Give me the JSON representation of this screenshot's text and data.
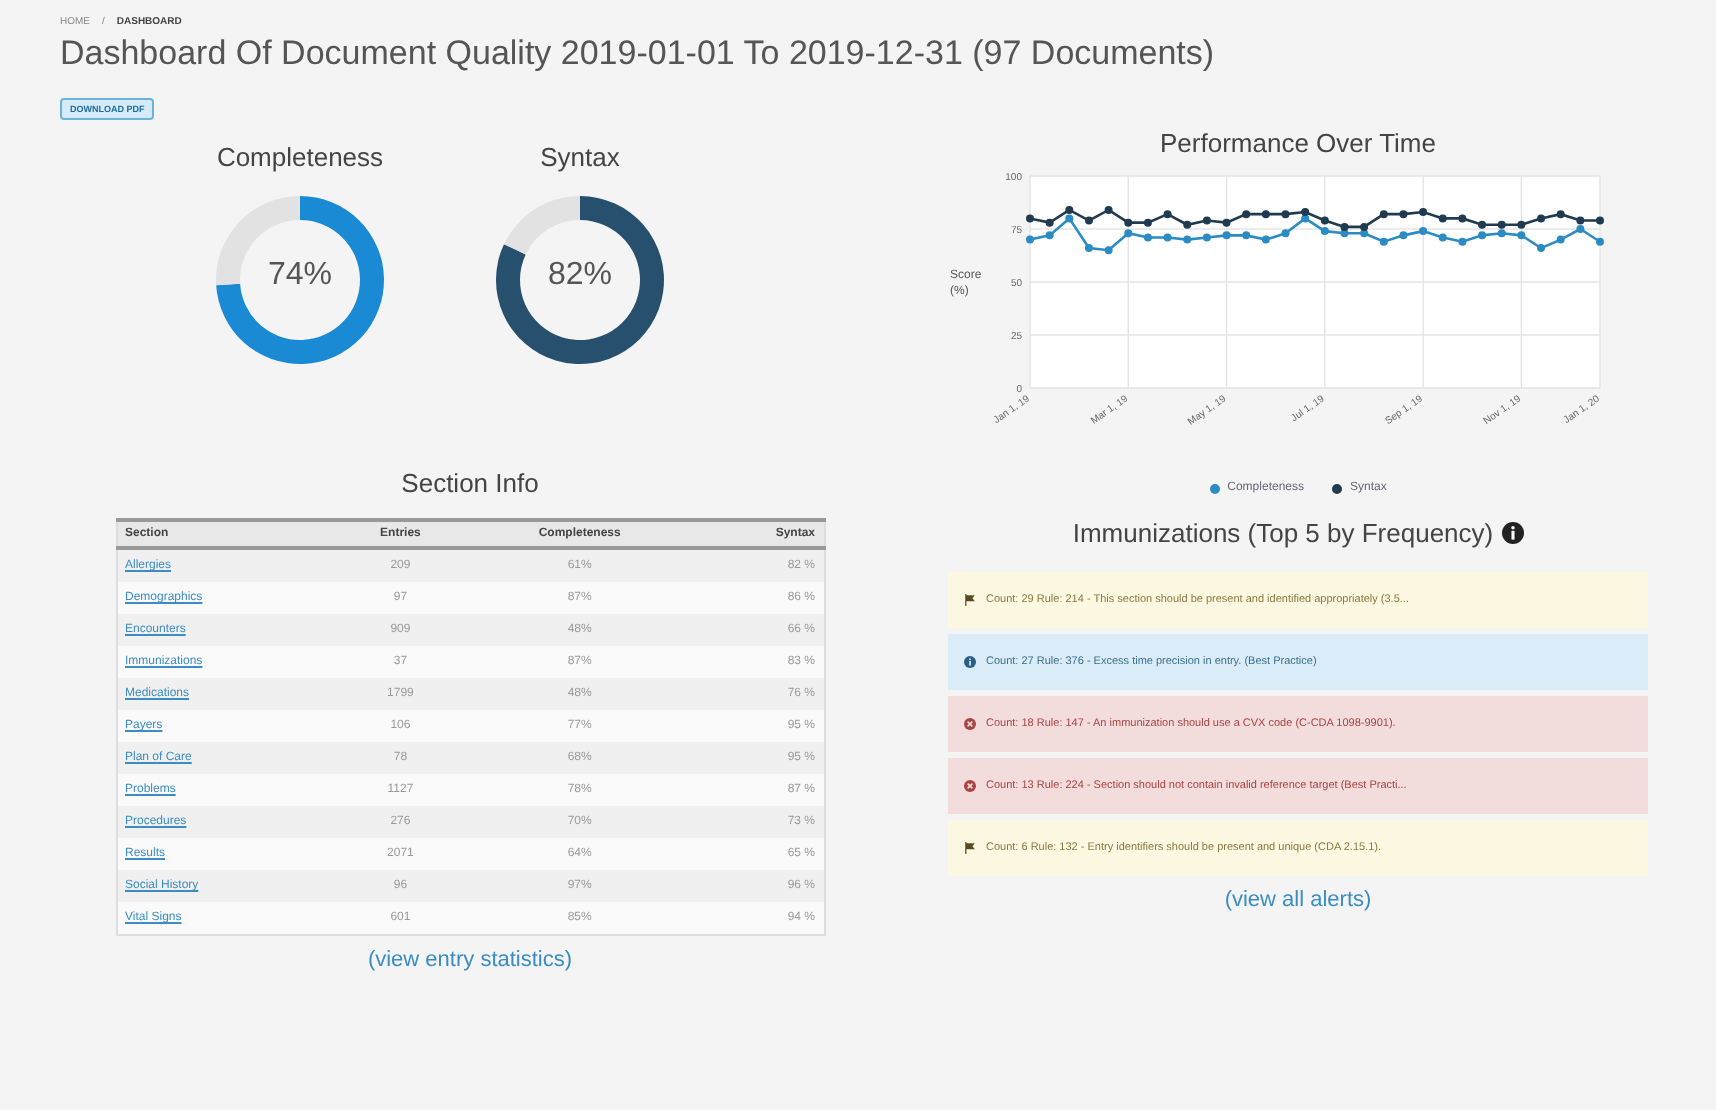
{
  "breadcrumb": [
    "HOME",
    "DASHBOARD"
  ],
  "breadcrumb_separator": "/",
  "title": "Dashboard Of Document Quality 2019-01-01 To 2019-12-31 (97 Documents)",
  "download_button": "DOWNLOAD PDF",
  "gauges": [
    {
      "title": "Completeness",
      "reading": "74%",
      "color": "#1a8ad4",
      "chart_data": {
        "type": "donut",
        "values": [
          74,
          26
        ]
      }
    },
    {
      "title": "Syntax",
      "reading": "82%",
      "color": "#27506e",
      "chart_data": {
        "type": "donut",
        "values": [
          82,
          18
        ]
      }
    }
  ],
  "performance": {
    "chart_data": {
      "type": "line",
      "title": "Performance Over Time",
      "ylabel": "Score (%)",
      "categories": [
        "Jan 1, 19",
        null,
        null,
        null,
        null,
        "Mar 1, 19",
        null,
        null,
        null,
        null,
        "May 1, 19",
        null,
        null,
        null,
        null,
        "Jul 1, 19",
        null,
        null,
        null,
        null,
        "Sep 1, 19",
        null,
        null,
        null,
        null,
        "Nov 1, 19",
        null,
        null,
        null,
        "Jan 1, 20"
      ],
      "grid": true,
      "ylim": [
        0,
        100
      ],
      "yticks": [
        0,
        25,
        50,
        75,
        100
      ],
      "series": [
        {
          "name": "Completeness",
          "color": "#2b8cc4",
          "marker": "circle",
          "values": [
            70,
            72,
            80,
            66,
            65,
            73,
            71,
            71,
            70,
            71,
            72,
            72,
            70,
            73,
            80,
            74,
            73,
            73,
            69,
            72,
            74,
            71,
            69,
            72,
            73,
            72,
            66,
            70,
            75,
            69
          ]
        },
        {
          "name": "Syntax",
          "color": "#203a4f",
          "marker": "circle",
          "values": [
            80,
            78,
            84,
            79,
            84,
            78,
            78,
            82,
            77,
            79,
            78,
            82,
            82,
            82,
            83,
            79,
            76,
            76,
            82,
            82,
            83,
            80,
            80,
            77,
            77,
            77,
            80,
            82,
            79,
            79
          ]
        }
      ]
    }
  },
  "section_info": {
    "title": "Section Info",
    "columns": [
      "Section",
      "Entries",
      "Completeness",
      "Syntax"
    ],
    "rows": [
      [
        "Allergies",
        "209",
        "61%",
        "82 %"
      ],
      [
        "Demographics",
        "97",
        "87%",
        "86 %"
      ],
      [
        "Encounters",
        "909",
        "48%",
        "66 %"
      ],
      [
        "Immunizations",
        "37",
        "87%",
        "83 %"
      ],
      [
        "Medications",
        "1799",
        "48%",
        "76 %"
      ],
      [
        "Payers",
        "106",
        "77%",
        "95 %"
      ],
      [
        "Plan of Care",
        "78",
        "68%",
        "95 %"
      ],
      [
        "Problems",
        "1127",
        "78%",
        "87 %"
      ],
      [
        "Procedures",
        "276",
        "70%",
        "73 %"
      ],
      [
        "Results",
        "2071",
        "64%",
        "65 %"
      ],
      [
        "Social History",
        "96",
        "97%",
        "96 %"
      ],
      [
        "Vital Signs",
        "601",
        "85%",
        "94 %"
      ]
    ],
    "link": "(view entry statistics)"
  },
  "immunizations": {
    "title": "Immunizations (Top 5 by Frequency)",
    "alerts": [
      {
        "kind": "warning",
        "text": "Count: 29 Rule: 214 - This section should be present and identified appropriately (3.5..."
      },
      {
        "kind": "info",
        "text": "Count: 27 Rule: 376 - Excess time precision in entry. (Best Practice)"
      },
      {
        "kind": "error",
        "text": "Count: 18 Rule: 147 - An immunization should use a CVX code (C-CDA 1098-9901)."
      },
      {
        "kind": "error",
        "text": "Count: 13 Rule: 224 - Section should not contain invalid reference target (Best Practi..."
      },
      {
        "kind": "warning",
        "text": "Count: 6 Rule: 132 - Entry identifiers should be present and unique (CDA 2.15.1)."
      }
    ],
    "link": "(view all alerts)"
  }
}
